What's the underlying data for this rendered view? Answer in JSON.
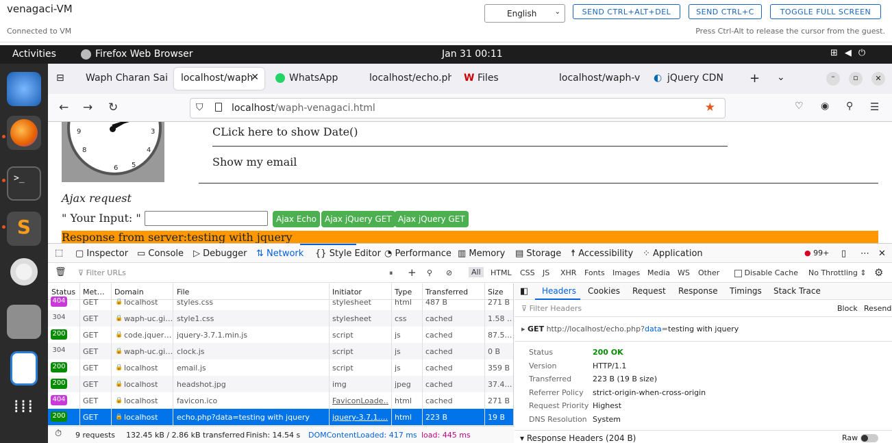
{
  "vm": {
    "title": "venagaci-VM",
    "status": "Connected to VM",
    "language": "English",
    "btn_cad": "SEND CTRL+ALT+DEL",
    "btn_ctrlc": "SEND CTRL+C",
    "btn_fullscreen": "TOGGLE FULL SCREEN",
    "hint": "Press Ctrl-Alt to release the cursor from the guest."
  },
  "gnome": {
    "activities": "Activities",
    "app": "Firefox Web Browser",
    "datetime": "Jan 31  00:11"
  },
  "tabs": [
    "Waph Charan Sai V",
    "localhost/waph",
    "WhatsApp",
    "localhost/echo.ph",
    "Files",
    "localhost/waph-v",
    "jQuery CDN"
  ],
  "url": {
    "host": "localhost",
    "path": "/waph-venagaci.html"
  },
  "page": {
    "date_link": "CLick here to show Date()",
    "email_link": "Show my email",
    "ajax_heading": "Ajax request",
    "input_label": "\" Your Input: \"",
    "btn_echo": "Ajax Echo",
    "btn_get1": "Ajax jQuery GET",
    "btn_get2": "Ajax jQuery GET",
    "response": "Response from server:testing with jquery",
    "clock_nums": [
      "9",
      "3",
      "8",
      "4",
      "6",
      "5"
    ]
  },
  "devtools": {
    "tabs": [
      "Inspector",
      "Console",
      "Debugger",
      "Network",
      "Style Editor",
      "Performance",
      "Memory",
      "Storage",
      "Accessibility",
      "Application"
    ],
    "error_count": "99+",
    "filter_placeholder": "Filter URLs",
    "types": [
      "All",
      "HTML",
      "CSS",
      "JS",
      "XHR",
      "Fonts",
      "Images",
      "Media",
      "WS",
      "Other"
    ],
    "disable_cache": "Disable Cache",
    "throttling": "No Throttling ⇕",
    "columns": [
      "Status",
      "Met…",
      "Domain",
      "File",
      "Initiator",
      "Type",
      "Transferred",
      "Size"
    ],
    "rows": [
      {
        "status": "404",
        "method": "GET",
        "domain": "localhost",
        "file": "styles.css",
        "initiator": "stylesheet",
        "type": "html",
        "transferred": "487 B",
        "size": "271 B"
      },
      {
        "status": "304",
        "method": "GET",
        "domain": "waph-uc.gi…",
        "file": "style1.css",
        "initiator": "stylesheet",
        "type": "css",
        "transferred": "cached",
        "size": "1.58 …"
      },
      {
        "status": "200",
        "method": "GET",
        "domain": "code.jquer…",
        "file": "jquery-3.7.1.min.js",
        "initiator": "script",
        "type": "js",
        "transferred": "cached",
        "size": "87.5…"
      },
      {
        "status": "304",
        "method": "GET",
        "domain": "waph-uc.gi…",
        "file": "clock.js",
        "initiator": "script",
        "type": "js",
        "transferred": "cached",
        "size": "0 B"
      },
      {
        "status": "200",
        "method": "GET",
        "domain": "localhost",
        "file": "email.js",
        "initiator": "script",
        "type": "js",
        "transferred": "cached",
        "size": "359 B"
      },
      {
        "status": "200",
        "method": "GET",
        "domain": "localhost",
        "file": "headshot.jpg",
        "initiator": "img",
        "type": "jpeg",
        "transferred": "cached",
        "size": "37.4…"
      },
      {
        "status": "404",
        "method": "GET",
        "domain": "localhost",
        "file": "favicon.ico",
        "initiator": "FaviconLoade…",
        "type": "html",
        "transferred": "cached",
        "size": "271 B"
      },
      {
        "status": "200",
        "method": "GET",
        "domain": "localhost",
        "file": "echo.php?data=testing with jquery",
        "initiator": "jquery-3.7.1.…",
        "type": "html",
        "transferred": "223 B",
        "size": "19 B"
      }
    ],
    "summary": {
      "requests": "9 requests",
      "transferred": "132.45 kB / 2.86 kB transferred",
      "finish": "Finish: 14.54 s",
      "dcl": "DOMContentLoaded: 417 ms",
      "load": "load: 445 ms"
    },
    "side_tabs": [
      "Headers",
      "Cookies",
      "Request",
      "Response",
      "Timings",
      "Stack Trace"
    ],
    "filter_headers": "Filter Headers",
    "block": "Block",
    "resend": "Resend",
    "request_line": {
      "method": "GET",
      "url_base": "http://localhost/echo.php?",
      "param_key": "data",
      "param_eq": "=",
      "param_val": "testing with jquery"
    },
    "details": [
      {
        "k": "Status",
        "v": "200 OK"
      },
      {
        "k": "Version",
        "v": "HTTP/1.1"
      },
      {
        "k": "Transferred",
        "v": "223 B (19 B size)"
      },
      {
        "k": "Referrer Policy",
        "v": "strict-origin-when-cross-origin"
      },
      {
        "k": "Request Priority",
        "v": "Highest"
      },
      {
        "k": "DNS Resolution",
        "v": "System"
      }
    ],
    "response_headers": "Response Headers (204 B)",
    "raw": "Raw"
  }
}
